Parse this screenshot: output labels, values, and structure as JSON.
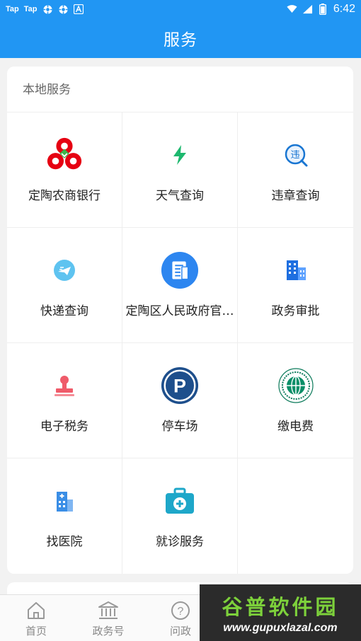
{
  "status_bar": {
    "app1": "Tap",
    "app2": "Tap",
    "time": "6:42",
    "icons": [
      "gear-icon",
      "gear-icon",
      "a-icon",
      "wifi-icon",
      "signal-icon",
      "battery-icon"
    ]
  },
  "header": {
    "title": "服务"
  },
  "section": {
    "title": "本地服务"
  },
  "services": [
    {
      "label": "定陶农商银行",
      "icon": "bank-logo-icon"
    },
    {
      "label": "天气查询",
      "icon": "lightning-icon"
    },
    {
      "label": "违章查询",
      "icon": "traffic-violation-icon"
    },
    {
      "label": "快递查询",
      "icon": "express-delivery-icon"
    },
    {
      "label": "定陶区人民政府官…",
      "icon": "government-document-icon"
    },
    {
      "label": "政务审批",
      "icon": "buildings-icon"
    },
    {
      "label": "电子税务",
      "icon": "stamp-icon"
    },
    {
      "label": "停车场",
      "icon": "parking-icon"
    },
    {
      "label": "缴电费",
      "icon": "state-grid-logo-icon"
    },
    {
      "label": "找医院",
      "icon": "hospital-icon"
    },
    {
      "label": "就诊服务",
      "icon": "medical-kit-icon"
    }
  ],
  "tabbar": {
    "items": [
      {
        "label": "首页",
        "icon": "home-icon"
      },
      {
        "label": "政务号",
        "icon": "government-building-icon"
      },
      {
        "label": "问政",
        "icon": "question-icon"
      }
    ]
  },
  "watermark": {
    "title": "谷普软件园",
    "url": "www.gupuxlazal.com"
  },
  "colors": {
    "primary": "#2196f3",
    "background": "#f2f2f2",
    "watermark_green": "#7dd13b"
  }
}
